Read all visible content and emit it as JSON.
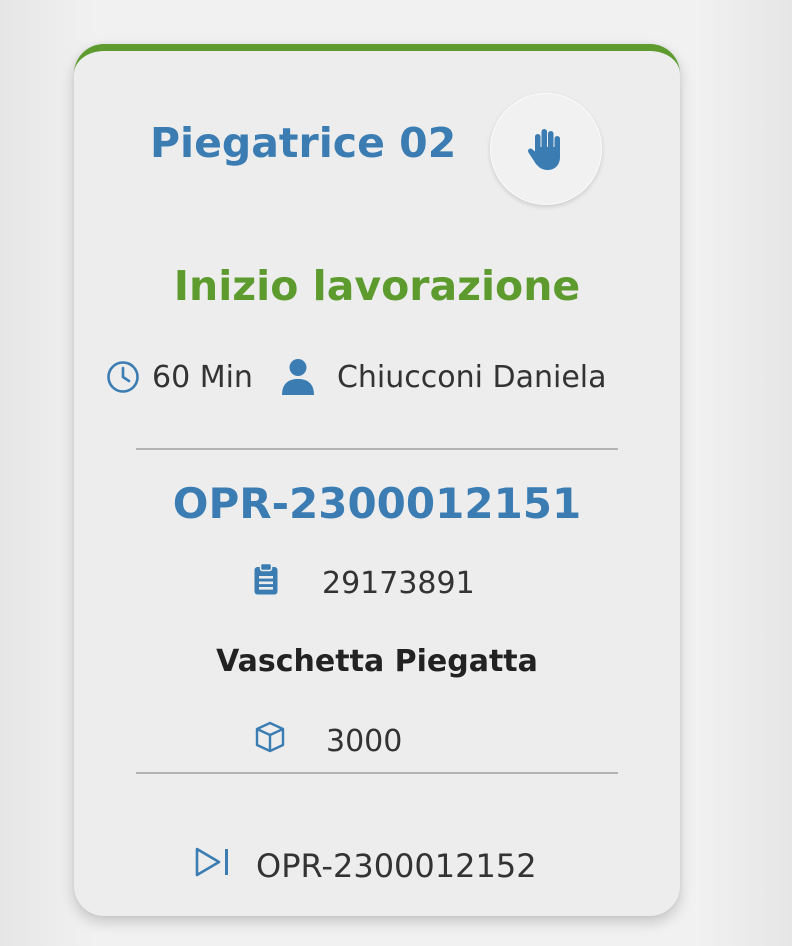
{
  "card": {
    "accent_color": "#5d9b2f",
    "machine_name": "Piegatrice 02",
    "hand_icon": "hand-stop-icon",
    "status": "Inizio lavorazione",
    "duration": "60 Min",
    "operator": "Chiucconi Daniela",
    "order_code": "OPR-2300012151",
    "item_code": "29173891",
    "product_name": "Vaschetta Piegatta",
    "quantity": "3000",
    "next_order": "OPR-2300012152"
  },
  "colors": {
    "brand_blue": "#3b7db3",
    "status_green": "#5d9b2f"
  }
}
